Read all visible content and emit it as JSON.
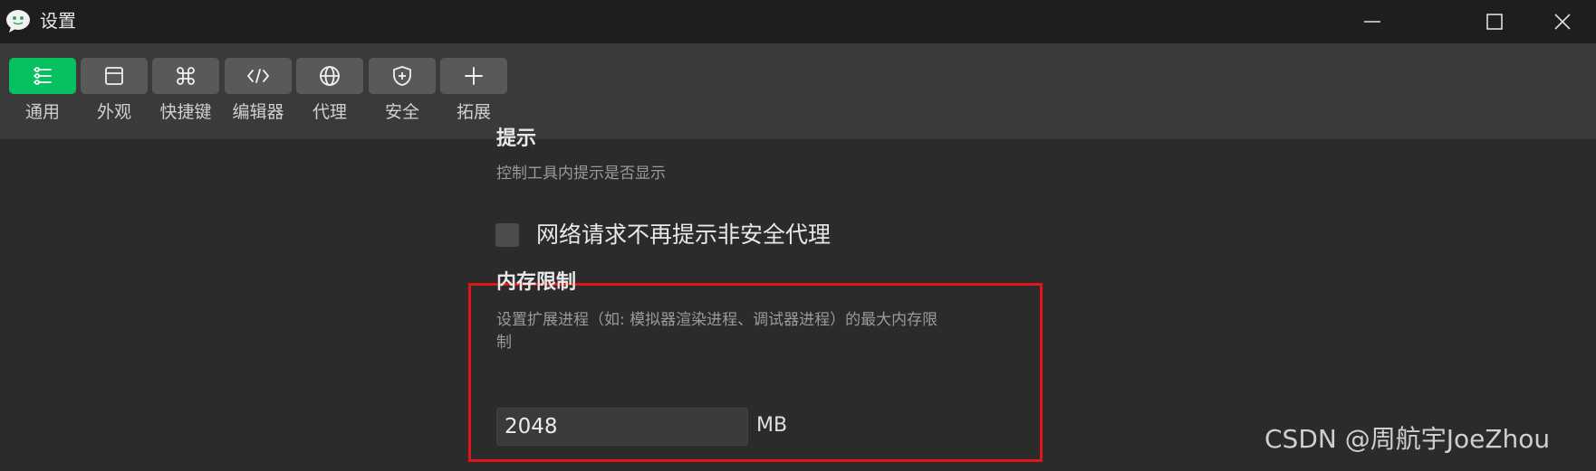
{
  "window": {
    "title": "设置",
    "app_icon": "wechat-chat-bubble-icon"
  },
  "toolbar": {
    "accent_color": "#07c160",
    "items": [
      {
        "label": "通用",
        "icon": "sliders-icon",
        "active": true
      },
      {
        "label": "外观",
        "icon": "window-layout-icon",
        "active": false
      },
      {
        "label": "快捷键",
        "icon": "command-key-icon",
        "active": false
      },
      {
        "label": "编辑器",
        "icon": "code-brackets-icon",
        "active": false
      },
      {
        "label": "代理",
        "icon": "globe-icon",
        "active": false
      },
      {
        "label": "安全",
        "icon": "shield-plus-icon",
        "active": false
      },
      {
        "label": "拓展",
        "icon": "plus-icon",
        "active": false
      }
    ]
  },
  "tips_section": {
    "title": "提示",
    "description": "控制工具内提示是否显示",
    "checkbox_label": "网络请求不再提示非安全代理",
    "checkbox_checked": false
  },
  "memory_section": {
    "title": "内存限制",
    "description_line1": "设置扩展进程（如: 模拟器渲染进程、调试器进程）的最大内存限",
    "description_line2": "制",
    "value": "2048",
    "unit": "MB",
    "highlight_color": "#e0141a"
  },
  "watermark": "CSDN @周航宇JoeZhou"
}
